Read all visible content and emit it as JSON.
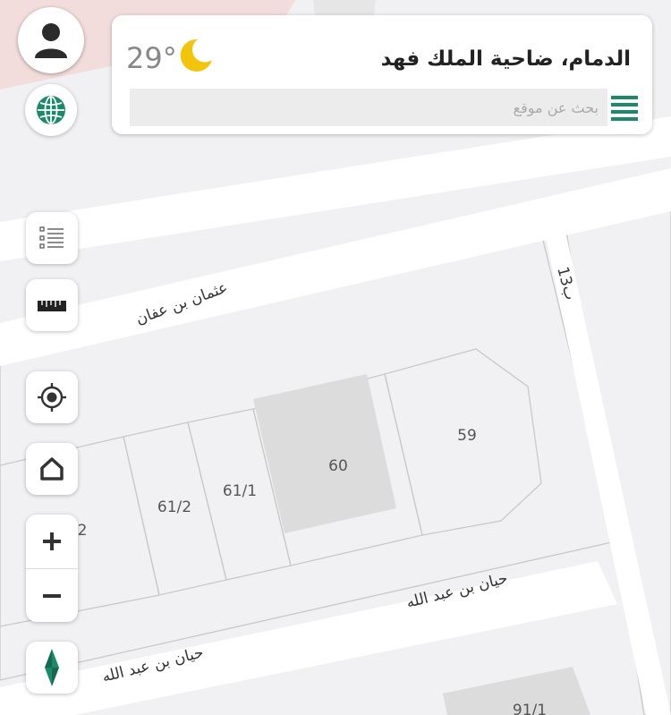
{
  "location": {
    "title": "الدمام، ضاحية الملك فهد"
  },
  "weather": {
    "temperature": "29°",
    "icon": "moon-icon"
  },
  "search": {
    "placeholder": "بحث عن موقع"
  },
  "map": {
    "streets": {
      "uthman": "عثمان بن عفان",
      "hayyan_upper": "حيان بن عبد الله",
      "hayyan_lower": "حيان بن عبد الله",
      "street_13": "13ب"
    },
    "parcels": {
      "p59": "59",
      "p60": "60",
      "p61_1": "61/1",
      "p61_2": "61/2",
      "p62_partial": "2",
      "p91_1": "91/1"
    }
  },
  "controls": {
    "avatar": "user-icon",
    "globe": "globe-icon",
    "layers": "list-icon",
    "measure": "ruler-icon",
    "locate": "crosshair-icon",
    "home": "home-icon",
    "zoom_in": "plus-icon",
    "zoom_out": "minus-icon",
    "compass": "compass-icon"
  },
  "colors": {
    "accent": "#1a8a6a",
    "map_background": "#f1f1f3",
    "road": "#ffffff",
    "building": "#dcdcdc",
    "icon_dark": "#333333"
  }
}
